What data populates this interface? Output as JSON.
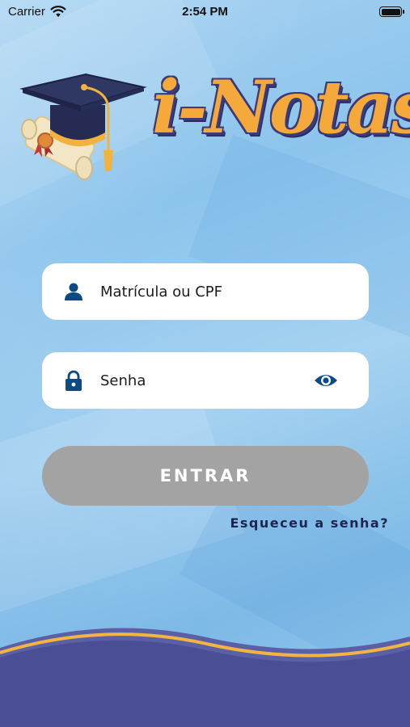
{
  "status_bar": {
    "carrier": "Carrier",
    "time": "2:54 PM"
  },
  "logo": {
    "text": "i-Notas",
    "icon": "graduation-cap-diploma-icon"
  },
  "login": {
    "user_field": {
      "placeholder": "Matrícula ou CPF",
      "value": "",
      "icon": "user-icon"
    },
    "password_field": {
      "placeholder": "Senha",
      "value": "",
      "icon": "lock-icon",
      "toggle_icon": "eye-icon"
    },
    "submit_label": "ENTRAR",
    "forgot_label": "Esqueceu a senha?"
  },
  "colors": {
    "background": "#9ccbee",
    "accent": "#0c4a86",
    "logo_text": "#f5a93a",
    "logo_outline": "#3b3a7a",
    "button_disabled": "#a3a3a3",
    "footer_wave": "#4a4e94",
    "footer_stripe": "#f2b544"
  }
}
